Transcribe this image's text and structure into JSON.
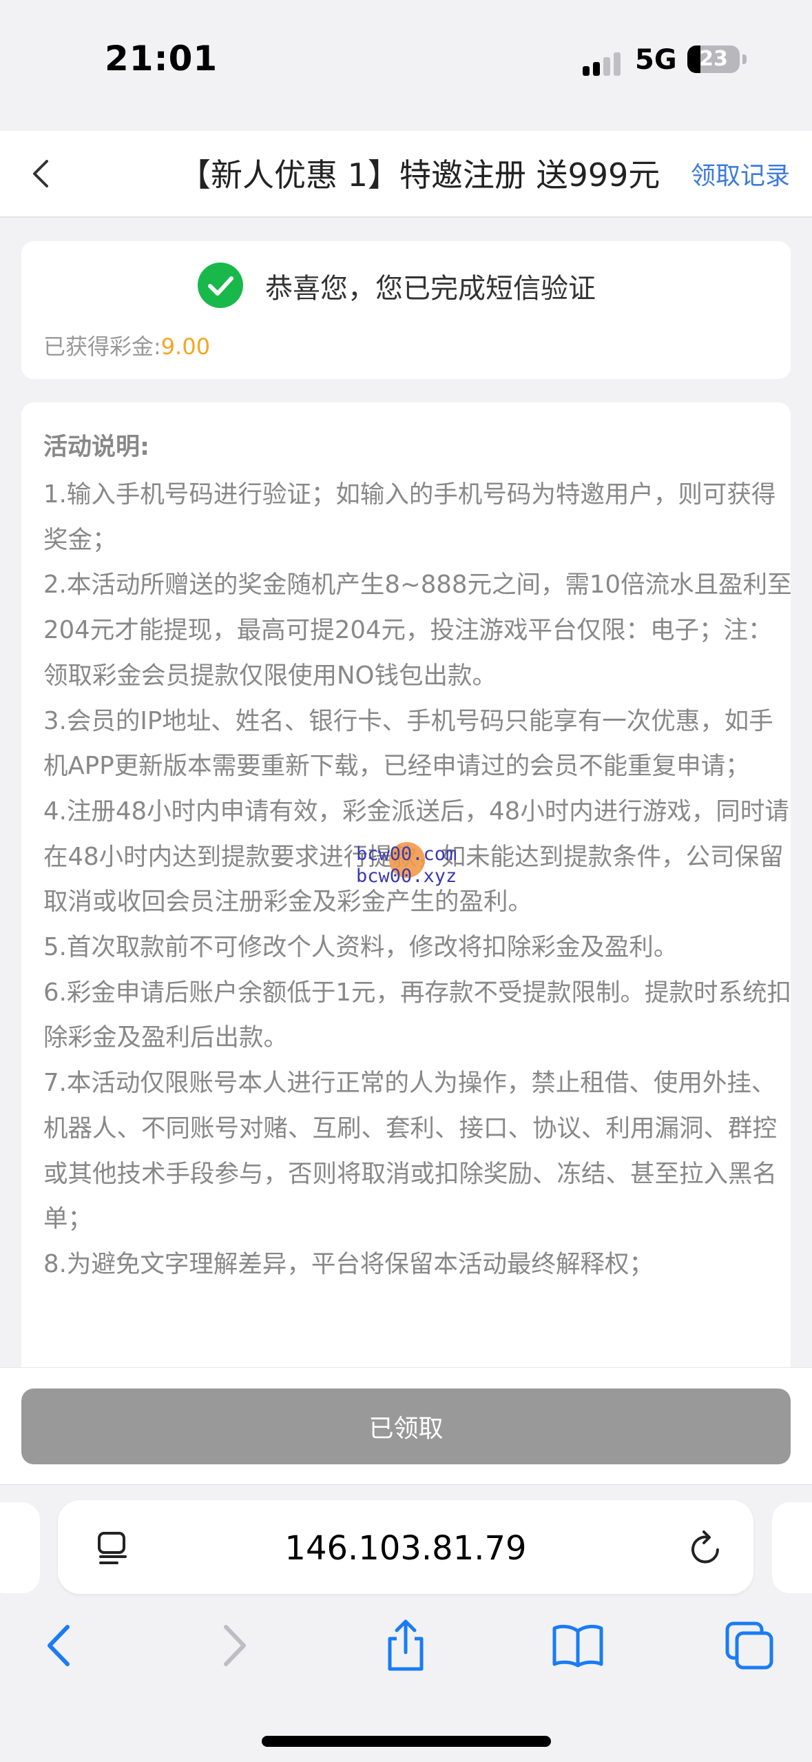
{
  "status_bar": {
    "time": "21:01",
    "network": "5G",
    "battery": "23"
  },
  "header": {
    "title": "【新人优惠 1】特邀注册 送999元",
    "records_link": "领取记录",
    "back_icon": "chevron-left-icon"
  },
  "success_card": {
    "icon": "check-circle-icon",
    "message": "恭喜您，您已完成短信验证",
    "bonus_label": "已获得彩金:",
    "bonus_value": "9.00"
  },
  "rules": {
    "title": "活动说明:",
    "items": [
      "1.输入手机号码进行验证；如输入的手机号码为特邀用户，则可获得奖金；",
      "2.本活动所赠送的奖金随机产生8~888元之间，需10倍流水且盈利至204元才能提现，最高可提204元，投注游戏平台仅限：电子；注：领取彩金会员提款仅限使用NO钱包出款。",
      "3.会员的IP地址、姓名、银行卡、手机号码只能享有一次优惠，如手机APP更新版本需要重新下载，已经申请过的会员不能重复申请；",
      "4.注册48小时内申请有效，彩金派送后，48小时内进行游戏，同时请在48小时内达到提款要求进行提款，如未能达到提款条件，公司保留取消或收回会员注册彩金及彩金产生的盈利。",
      "5.首次取款前不可修改个人资料，修改将扣除彩金及盈利。",
      "6.彩金申请后账户余额低于1元，再存款不受提款限制。提款时系统扣除彩金及盈利后出款。",
      "7.本活动仅限账号本人进行正常的人为操作，禁止租借、使用外挂、机器人、不同账号对赌、互刷、套利、接口、协议、利用漏洞、群控或其他技术手段参与，否则将取消或扣除奖励、冻结、甚至拉入黑名单；",
      "8.为避免文字理解差异，平台将保留本活动最终解释权；"
    ]
  },
  "watermark": {
    "line1": "bcw00.com",
    "line2": "bcw00.xyz"
  },
  "action": {
    "claimed_label": "已领取"
  },
  "browser": {
    "url": "146.103.81.79",
    "icons": [
      "reader-icon",
      "reload-icon",
      "back-icon",
      "forward-icon",
      "share-icon",
      "bookmarks-icon",
      "tabs-icon"
    ]
  },
  "colors": {
    "accent_link": "#3d7bdc",
    "bonus_orange": "#f5a623",
    "success_green": "#19b84a",
    "button_gray": "#999999",
    "ios_blue": "#1a7cf5"
  }
}
